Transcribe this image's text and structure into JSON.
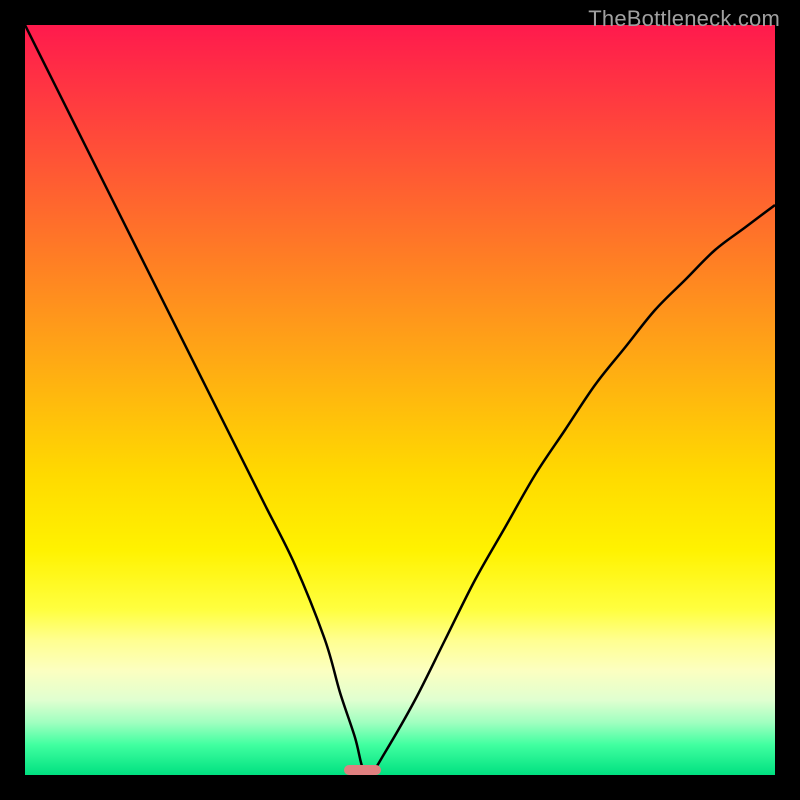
{
  "watermark": "TheBottleneck.com",
  "chart_data": {
    "type": "line",
    "title": "",
    "xlabel": "",
    "ylabel": "",
    "xlim": [
      0,
      100
    ],
    "ylim": [
      0,
      100
    ],
    "grid": false,
    "legend": false,
    "series": [
      {
        "name": "bottleneck-curve",
        "x": [
          0,
          4,
          8,
          12,
          16,
          20,
          24,
          28,
          32,
          36,
          40,
          42,
          44,
          45,
          46,
          48,
          52,
          56,
          60,
          64,
          68,
          72,
          76,
          80,
          84,
          88,
          92,
          96,
          100
        ],
        "values": [
          100,
          92,
          84,
          76,
          68,
          60,
          52,
          44,
          36,
          28,
          18,
          11,
          5,
          1,
          0,
          3,
          10,
          18,
          26,
          33,
          40,
          46,
          52,
          57,
          62,
          66,
          70,
          73,
          76
        ]
      }
    ],
    "marker": {
      "x": 45,
      "y": 0,
      "width_pct": 5,
      "height_pct": 1.4,
      "color": "#e08080"
    },
    "gradient_stops": [
      {
        "pos": 0,
        "color": "#ff1a4d"
      },
      {
        "pos": 50,
        "color": "#ffda00"
      },
      {
        "pos": 85,
        "color": "#ffffb0"
      },
      {
        "pos": 100,
        "color": "#00e080"
      }
    ]
  }
}
